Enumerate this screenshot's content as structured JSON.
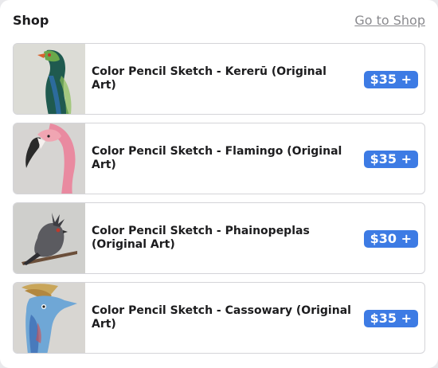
{
  "header": {
    "title": "Shop",
    "link_label": "Go to Shop"
  },
  "items": [
    {
      "title": "Color Pencil Sketch - Kererū (Original Art)",
      "price_label": "$35 +",
      "image": "kereru-sketch"
    },
    {
      "title": "Color Pencil Sketch - Flamingo (Original Art)",
      "price_label": "$35 +",
      "image": "flamingo-sketch"
    },
    {
      "title": "Color Pencil Sketch - Phainopeplas (Original Art)",
      "price_label": "$30 +",
      "image": "phainopepla-sketch"
    },
    {
      "title": "Color Pencil Sketch - Cassowary (Original Art)",
      "price_label": "$35 +",
      "image": "cassowary-sketch"
    }
  ],
  "colors": {
    "accent": "#3d7be4",
    "link": "#8a8a8e",
    "border": "#d4d4d8"
  }
}
